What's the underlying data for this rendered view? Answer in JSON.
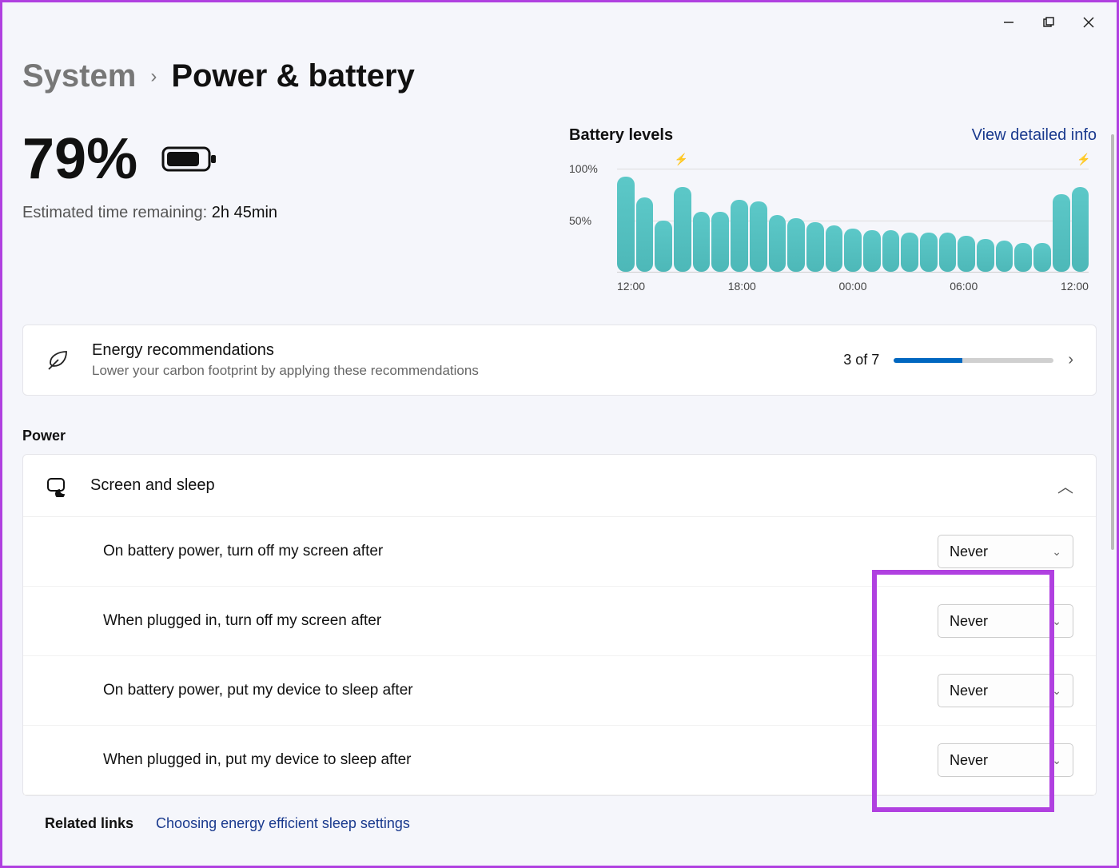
{
  "breadcrumb": {
    "parent": "System",
    "current": "Power & battery"
  },
  "battery": {
    "percent": "79%",
    "est_label": "Estimated time remaining:",
    "est_value": "2h 45min"
  },
  "chart": {
    "title": "Battery levels",
    "link": "View detailed info"
  },
  "chart_data": {
    "type": "bar",
    "title": "Battery levels",
    "ylabel": "",
    "ylim": [
      0,
      100
    ],
    "y_ticks": [
      "50%",
      "100%"
    ],
    "x_ticks": [
      "12:00",
      "18:00",
      "00:00",
      "06:00",
      "12:00"
    ],
    "categories": [
      "12:00",
      "13:00",
      "14:00",
      "15:00",
      "16:00",
      "17:00",
      "18:00",
      "19:00",
      "20:00",
      "21:00",
      "22:00",
      "23:00",
      "00:00",
      "01:00",
      "02:00",
      "03:00",
      "04:00",
      "05:00",
      "06:00",
      "07:00",
      "08:00",
      "09:00",
      "10:00",
      "11:00",
      "12:00"
    ],
    "values": [
      92,
      72,
      50,
      82,
      58,
      58,
      70,
      68,
      55,
      52,
      48,
      45,
      42,
      40,
      40,
      38,
      38,
      38,
      35,
      32,
      30,
      28,
      28,
      75,
      82
    ],
    "charging_markers": [
      3,
      24
    ]
  },
  "energy": {
    "title": "Energy recommendations",
    "subtitle": "Lower your carbon footprint by applying these recommendations",
    "count": "3 of 7",
    "progress_pct": 43
  },
  "power_section": "Power",
  "sleep": {
    "title": "Screen and sleep",
    "rows": [
      {
        "label": "On battery power, turn off my screen after",
        "value": "Never"
      },
      {
        "label": "When plugged in, turn off my screen after",
        "value": "Never"
      },
      {
        "label": "On battery power, put my device to sleep after",
        "value": "Never"
      },
      {
        "label": "When plugged in, put my device to sleep after",
        "value": "Never"
      }
    ]
  },
  "related": {
    "label": "Related links",
    "link": "Choosing energy efficient sleep settings"
  }
}
